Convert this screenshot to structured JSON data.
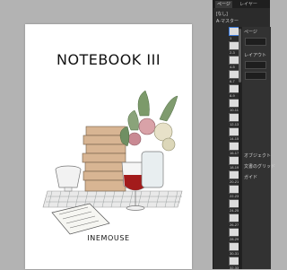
{
  "document": {
    "title": "NOTEBOOK III",
    "author": "INEMOUSE"
  },
  "pages_panel": {
    "tab_labels": [
      "ページ",
      "レイヤー"
    ],
    "header_a": "[なし]",
    "header_b": "A-マスター",
    "page_labels": [
      "1",
      "2-3",
      "4-5",
      "6-7",
      "8-9",
      "10-11",
      "12-13",
      "14-15",
      "16-17",
      "18-19",
      "20-21",
      "22-23",
      "24-25",
      "26-27",
      "28-29",
      "30-31",
      "32-33"
    ]
  },
  "properties_panel": {
    "labels": [
      "ページ",
      "レイアウト",
      "",
      "",
      "",
      "",
      "",
      "",
      "",
      "オブジェクト",
      "文書のグリッド",
      "ガイド"
    ]
  }
}
